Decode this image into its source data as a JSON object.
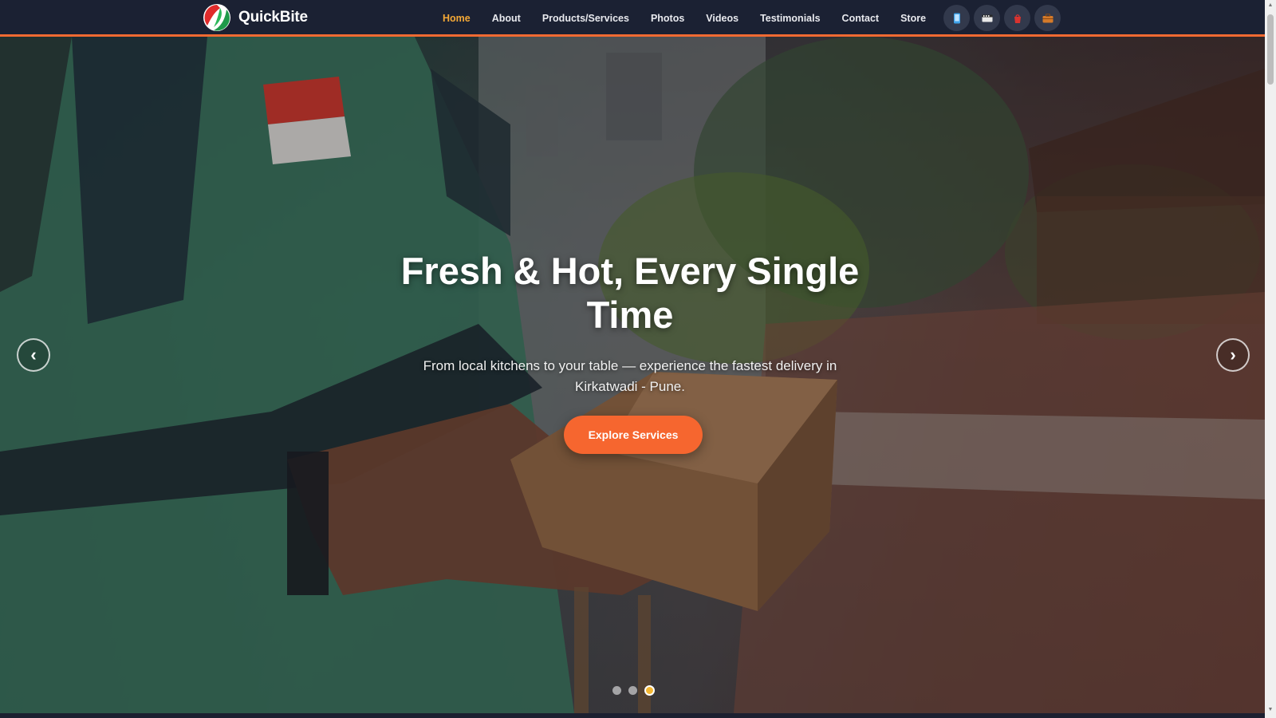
{
  "brand": {
    "name": "QuickBite"
  },
  "nav": {
    "items": [
      {
        "label": "Home",
        "active": true
      },
      {
        "label": "About"
      },
      {
        "label": "Products/Services"
      },
      {
        "label": "Photos"
      },
      {
        "label": "Videos"
      },
      {
        "label": "Testimonials"
      },
      {
        "label": "Contact"
      },
      {
        "label": "Store"
      }
    ]
  },
  "social": [
    {
      "icon": "phone-icon"
    },
    {
      "icon": "film-icon"
    },
    {
      "icon": "store-bag-icon"
    },
    {
      "icon": "briefcase-icon"
    }
  ],
  "hero": {
    "title": "Fresh & Hot, Every Single Time",
    "subtitle": "From local kitchens to your table — experience the fastest delivery in Kirkatwadi - Pune.",
    "cta_label": "Explore Services",
    "prev_label": "‹",
    "next_label": "›",
    "slides_total": 3,
    "active_slide": 3
  },
  "colors": {
    "header_bg": "#1b2133",
    "accent_orange": "#f6662f",
    "active_nav": "#f4a836",
    "active_dot": "#f4b632"
  }
}
